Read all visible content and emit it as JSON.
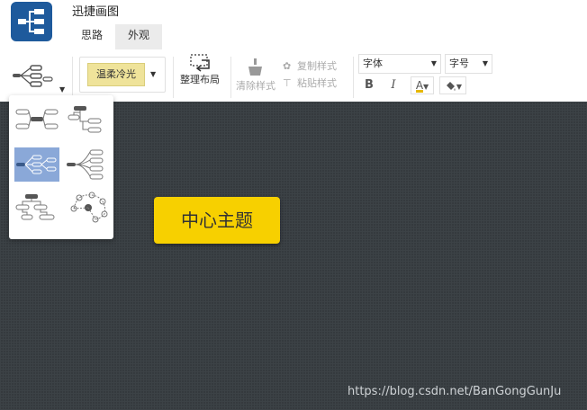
{
  "app": {
    "title": "迅捷画图",
    "logo_icon": "mindmap-logo-icon"
  },
  "tabs": [
    {
      "label": "思路",
      "active": false
    },
    {
      "label": "外观",
      "active": true
    }
  ],
  "toolbar": {
    "layout_icon": "mindmap-layout-icon",
    "theme_label": "温柔冷光",
    "tidy_label": "整理布局",
    "clear_style_label": "清除样式",
    "copy_style_label": "复制样式",
    "paste_style_label": "粘贴样式",
    "font_placeholder": "字体",
    "size_placeholder": "字号",
    "bold_label": "B",
    "italic_label": "I",
    "font_color_label": "A",
    "fill_icon": "fill-bucket-icon",
    "accent_color": "#f7d000"
  },
  "layout_menu": {
    "options": [
      {
        "name": "layout-logic-both-sides",
        "selected": false
      },
      {
        "name": "layout-org-tree-right",
        "selected": false
      },
      {
        "name": "layout-logic-right",
        "selected": true
      },
      {
        "name": "layout-fishbone-right",
        "selected": false
      },
      {
        "name": "layout-org-chart-down",
        "selected": false
      },
      {
        "name": "layout-bubble",
        "selected": false
      }
    ],
    "selected_color": "#8aa8d8"
  },
  "canvas": {
    "central_topic": "中心主题",
    "background_color": "#353a3e"
  },
  "watermark": "https://blog.csdn.net/BanGongGunJu"
}
